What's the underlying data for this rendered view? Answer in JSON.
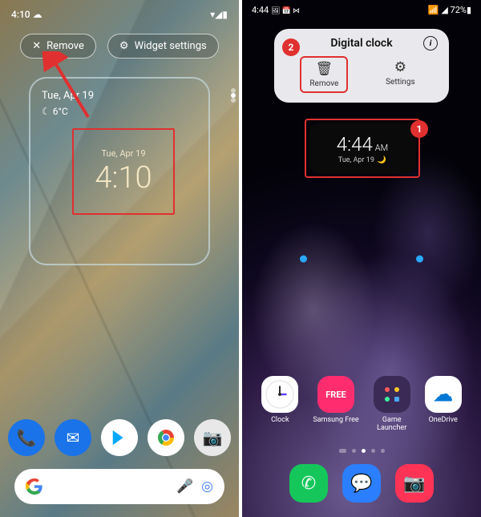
{
  "left": {
    "status": {
      "time": "4:10",
      "cloud": "☁",
      "right": "▾◢▮"
    },
    "remove": {
      "icon": "✕",
      "label": "Remove"
    },
    "settings": {
      "icon": "⚙",
      "label": "Widget settings"
    },
    "widget": {
      "date": "Tue, Apr 19",
      "temp_icon": "☾",
      "temp": "6°C",
      "clock_date": "Tue, Apr 19",
      "clock_time": "4:10"
    },
    "dock": {
      "phone": {
        "glyph": "📞",
        "bg": "#1a73e8"
      },
      "messages": {
        "glyph": "✉",
        "bg": "#1a73e8"
      },
      "play": {
        "glyph": "▶",
        "bg": "#fff"
      },
      "chrome": {
        "glyph": "",
        "bg": "#fff"
      },
      "camera": {
        "glyph": "📷",
        "bg": "#e8e8e8"
      }
    },
    "search": {
      "mic": "🎤",
      "lens": "◎"
    }
  },
  "right": {
    "status": {
      "time": "4:44",
      "icons": "🖼 📅 ⋈",
      "right": "📶 ◢ 72%▮"
    },
    "popup": {
      "title": "Digital clock",
      "info": "i",
      "remove_icon": "🗑",
      "remove_label": "Remove",
      "settings_icon": "⚙",
      "settings_label": "Settings"
    },
    "badges": {
      "one": "1",
      "two": "2"
    },
    "widget": {
      "time": "4:44",
      "ampm": "AM",
      "date": "Tue, Apr 19",
      "moon": "🌙"
    },
    "apps": [
      {
        "name": "clock",
        "label": "Clock",
        "bg": "#fff",
        "glyph": ""
      },
      {
        "name": "samsung-free",
        "label": "Samsung Free",
        "bg": "#ff2d6f",
        "glyph": "FREE"
      },
      {
        "name": "game-launcher",
        "label": "Game\nLauncher",
        "bg": "#3a2a55",
        "glyph": "::"
      },
      {
        "name": "onedrive",
        "label": "OneDrive",
        "bg": "#fff",
        "glyph": "☁"
      }
    ],
    "dock": [
      {
        "name": "phone",
        "bg": "#15c75a",
        "glyph": "✆"
      },
      {
        "name": "messages",
        "bg": "#2b7fff",
        "glyph": "💬"
      },
      {
        "name": "camera",
        "bg": "#ff3355",
        "glyph": "📷"
      }
    ]
  }
}
